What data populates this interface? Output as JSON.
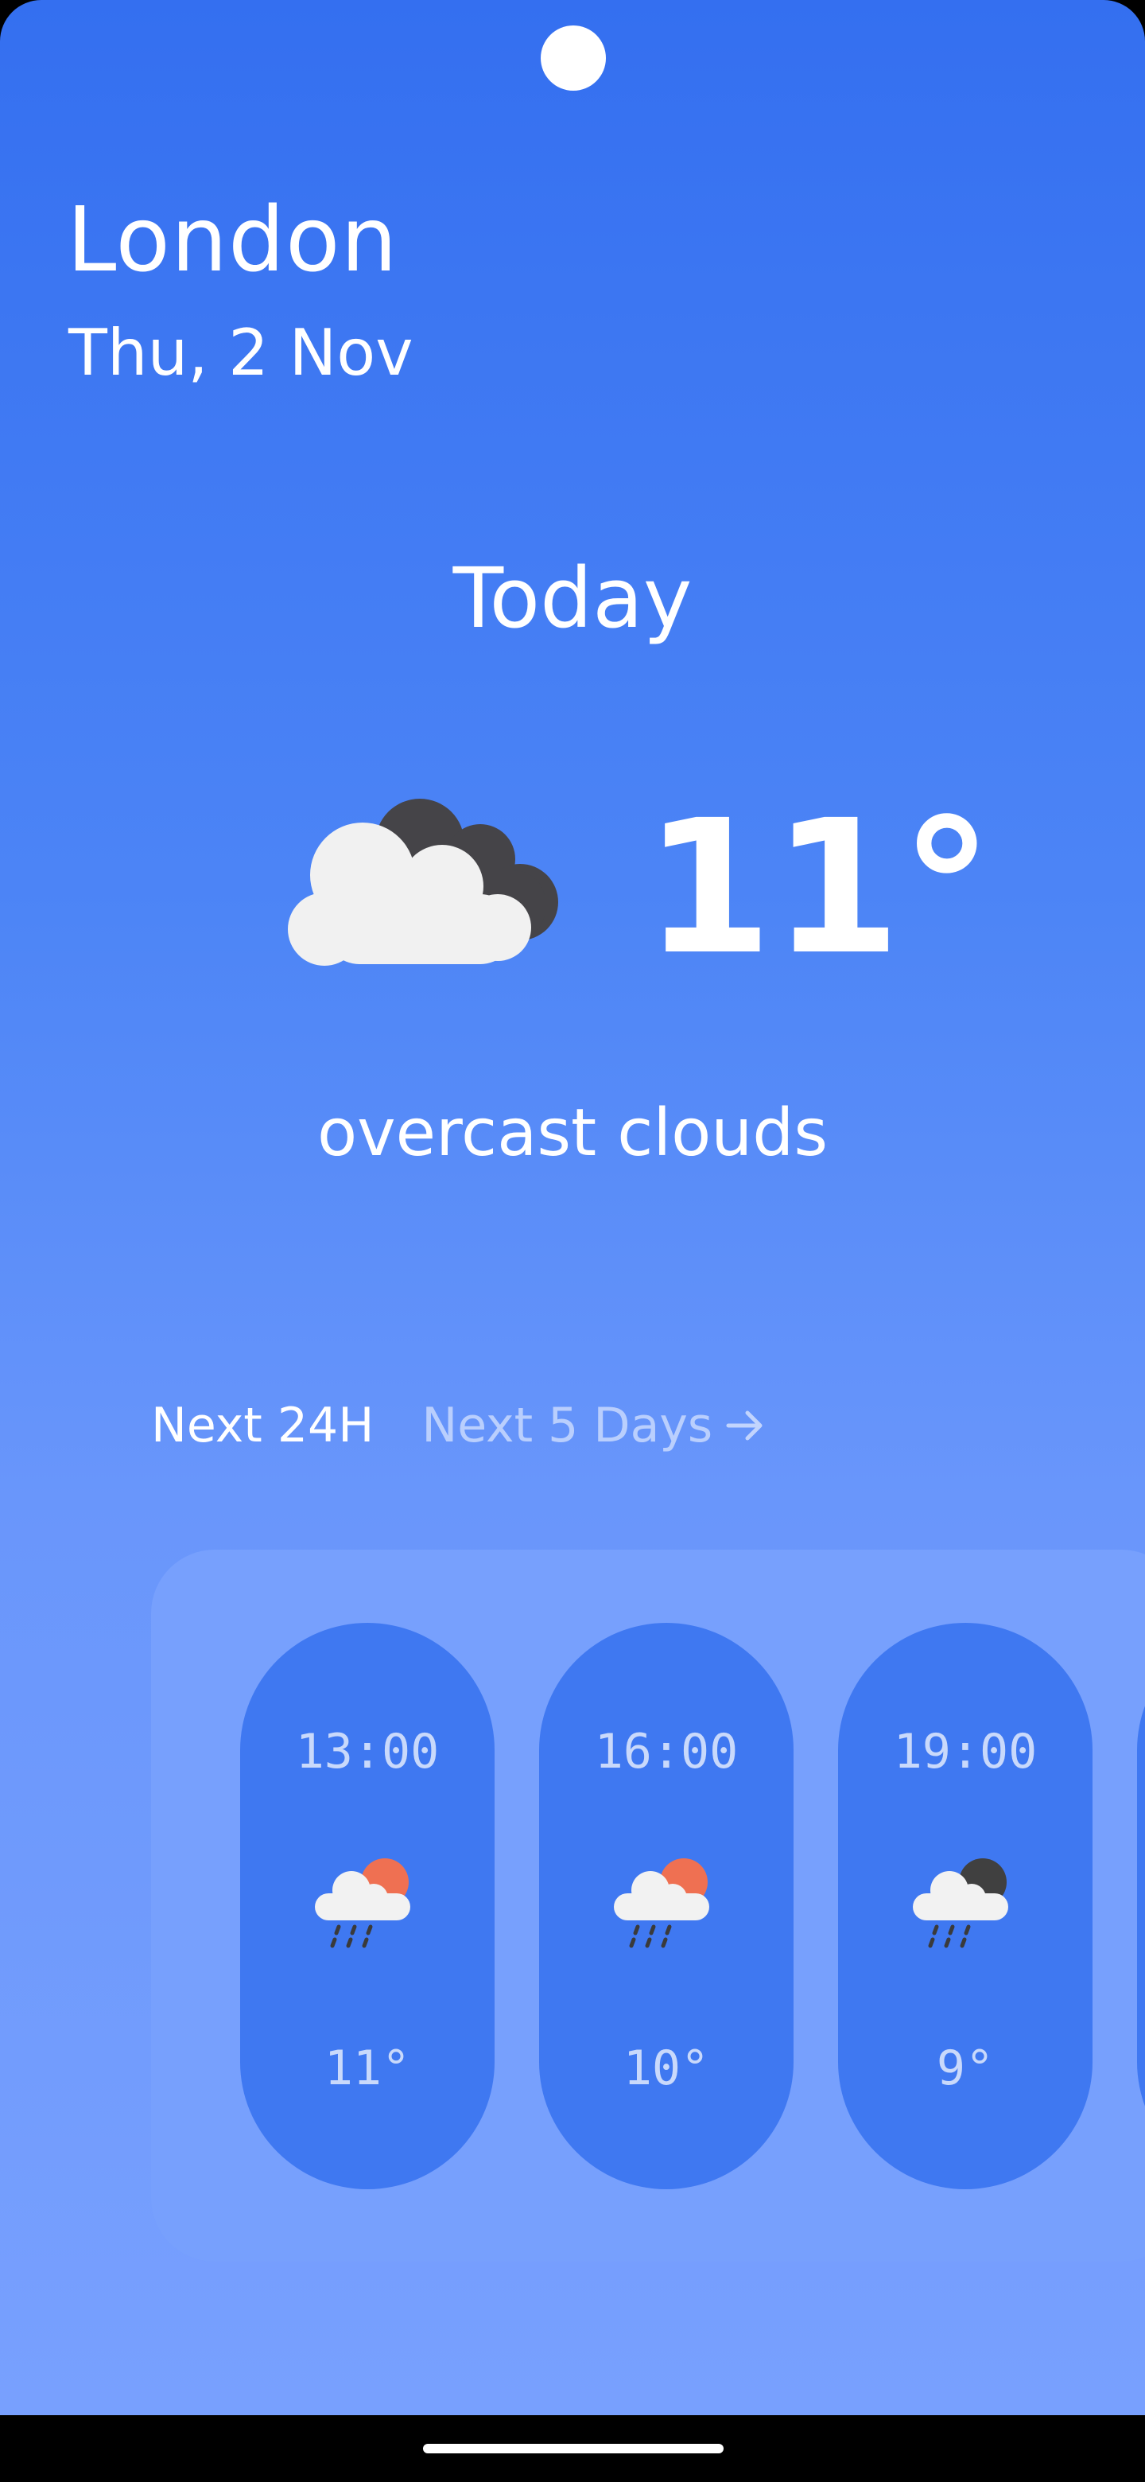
{
  "location": {
    "city": "London",
    "date": "Thu, 2 Nov"
  },
  "current": {
    "heading": "Today",
    "temperature": "11°",
    "condition": "overcast clouds",
    "icon": "overcast-clouds-icon"
  },
  "tabs": {
    "active": "Next 24H",
    "inactive": "Next 5 Days"
  },
  "hourly": [
    {
      "time": "13:00",
      "temp": "11°",
      "icon": "rain-sun-icon"
    },
    {
      "time": "16:00",
      "temp": "10°",
      "icon": "rain-sun-icon"
    },
    {
      "time": "19:00",
      "temp": "9°",
      "icon": "rain-moon-icon"
    }
  ],
  "colors": {
    "background_top": "#346ff0",
    "background_bottom": "#78a0fe",
    "panel": "#77a0fd",
    "card": "#3f78f1",
    "sun": "#ef7052",
    "moon": "#404040",
    "cloud": "#f2f2f2"
  }
}
